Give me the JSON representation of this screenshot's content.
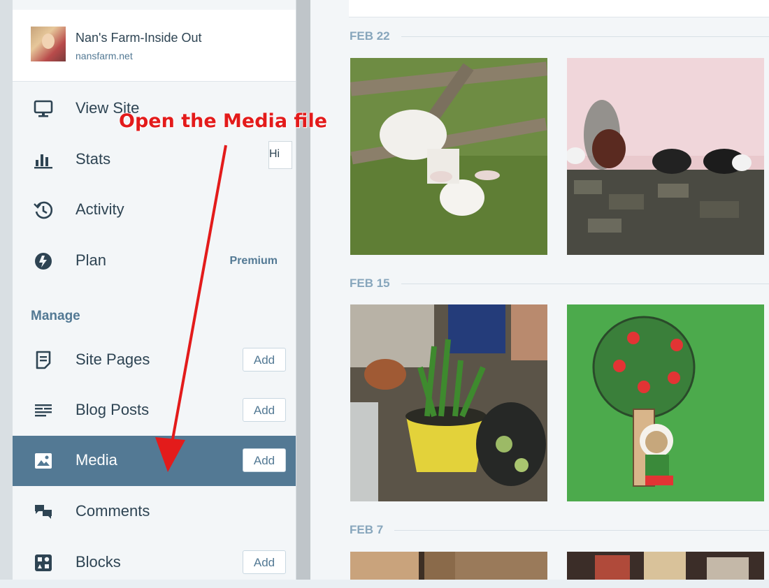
{
  "site": {
    "name": "Nan's Farm-Inside Out",
    "url": "nansfarm.net"
  },
  "nav": {
    "view_site": "View Site",
    "stats": "Stats",
    "activity": "Activity",
    "plan": "Plan",
    "plan_badge": "Premium",
    "manage_heading": "Manage",
    "site_pages": "Site Pages",
    "blog_posts": "Blog Posts",
    "media": "Media",
    "comments": "Comments",
    "blocks": "Blocks",
    "add_label": "Add",
    "active_item": "Media"
  },
  "annotation": {
    "text": "Open the Media file",
    "color": "#e31b1b"
  },
  "hint_fragment": "Hi",
  "media": {
    "groups": [
      {
        "date": "FEB 22",
        "items": [
          "sheep-photo",
          "cows-photo"
        ]
      },
      {
        "date": "FEB 15",
        "items": [
          "plants-photo",
          "tree-illustration"
        ]
      },
      {
        "date": "FEB 7",
        "items": [
          "room-photo",
          "shelf-photo"
        ]
      }
    ]
  },
  "colors": {
    "accent": "#537994",
    "sidebar_bg": "#f3f6f8",
    "date_header": "#87a6bc",
    "text": "#2e4453"
  }
}
